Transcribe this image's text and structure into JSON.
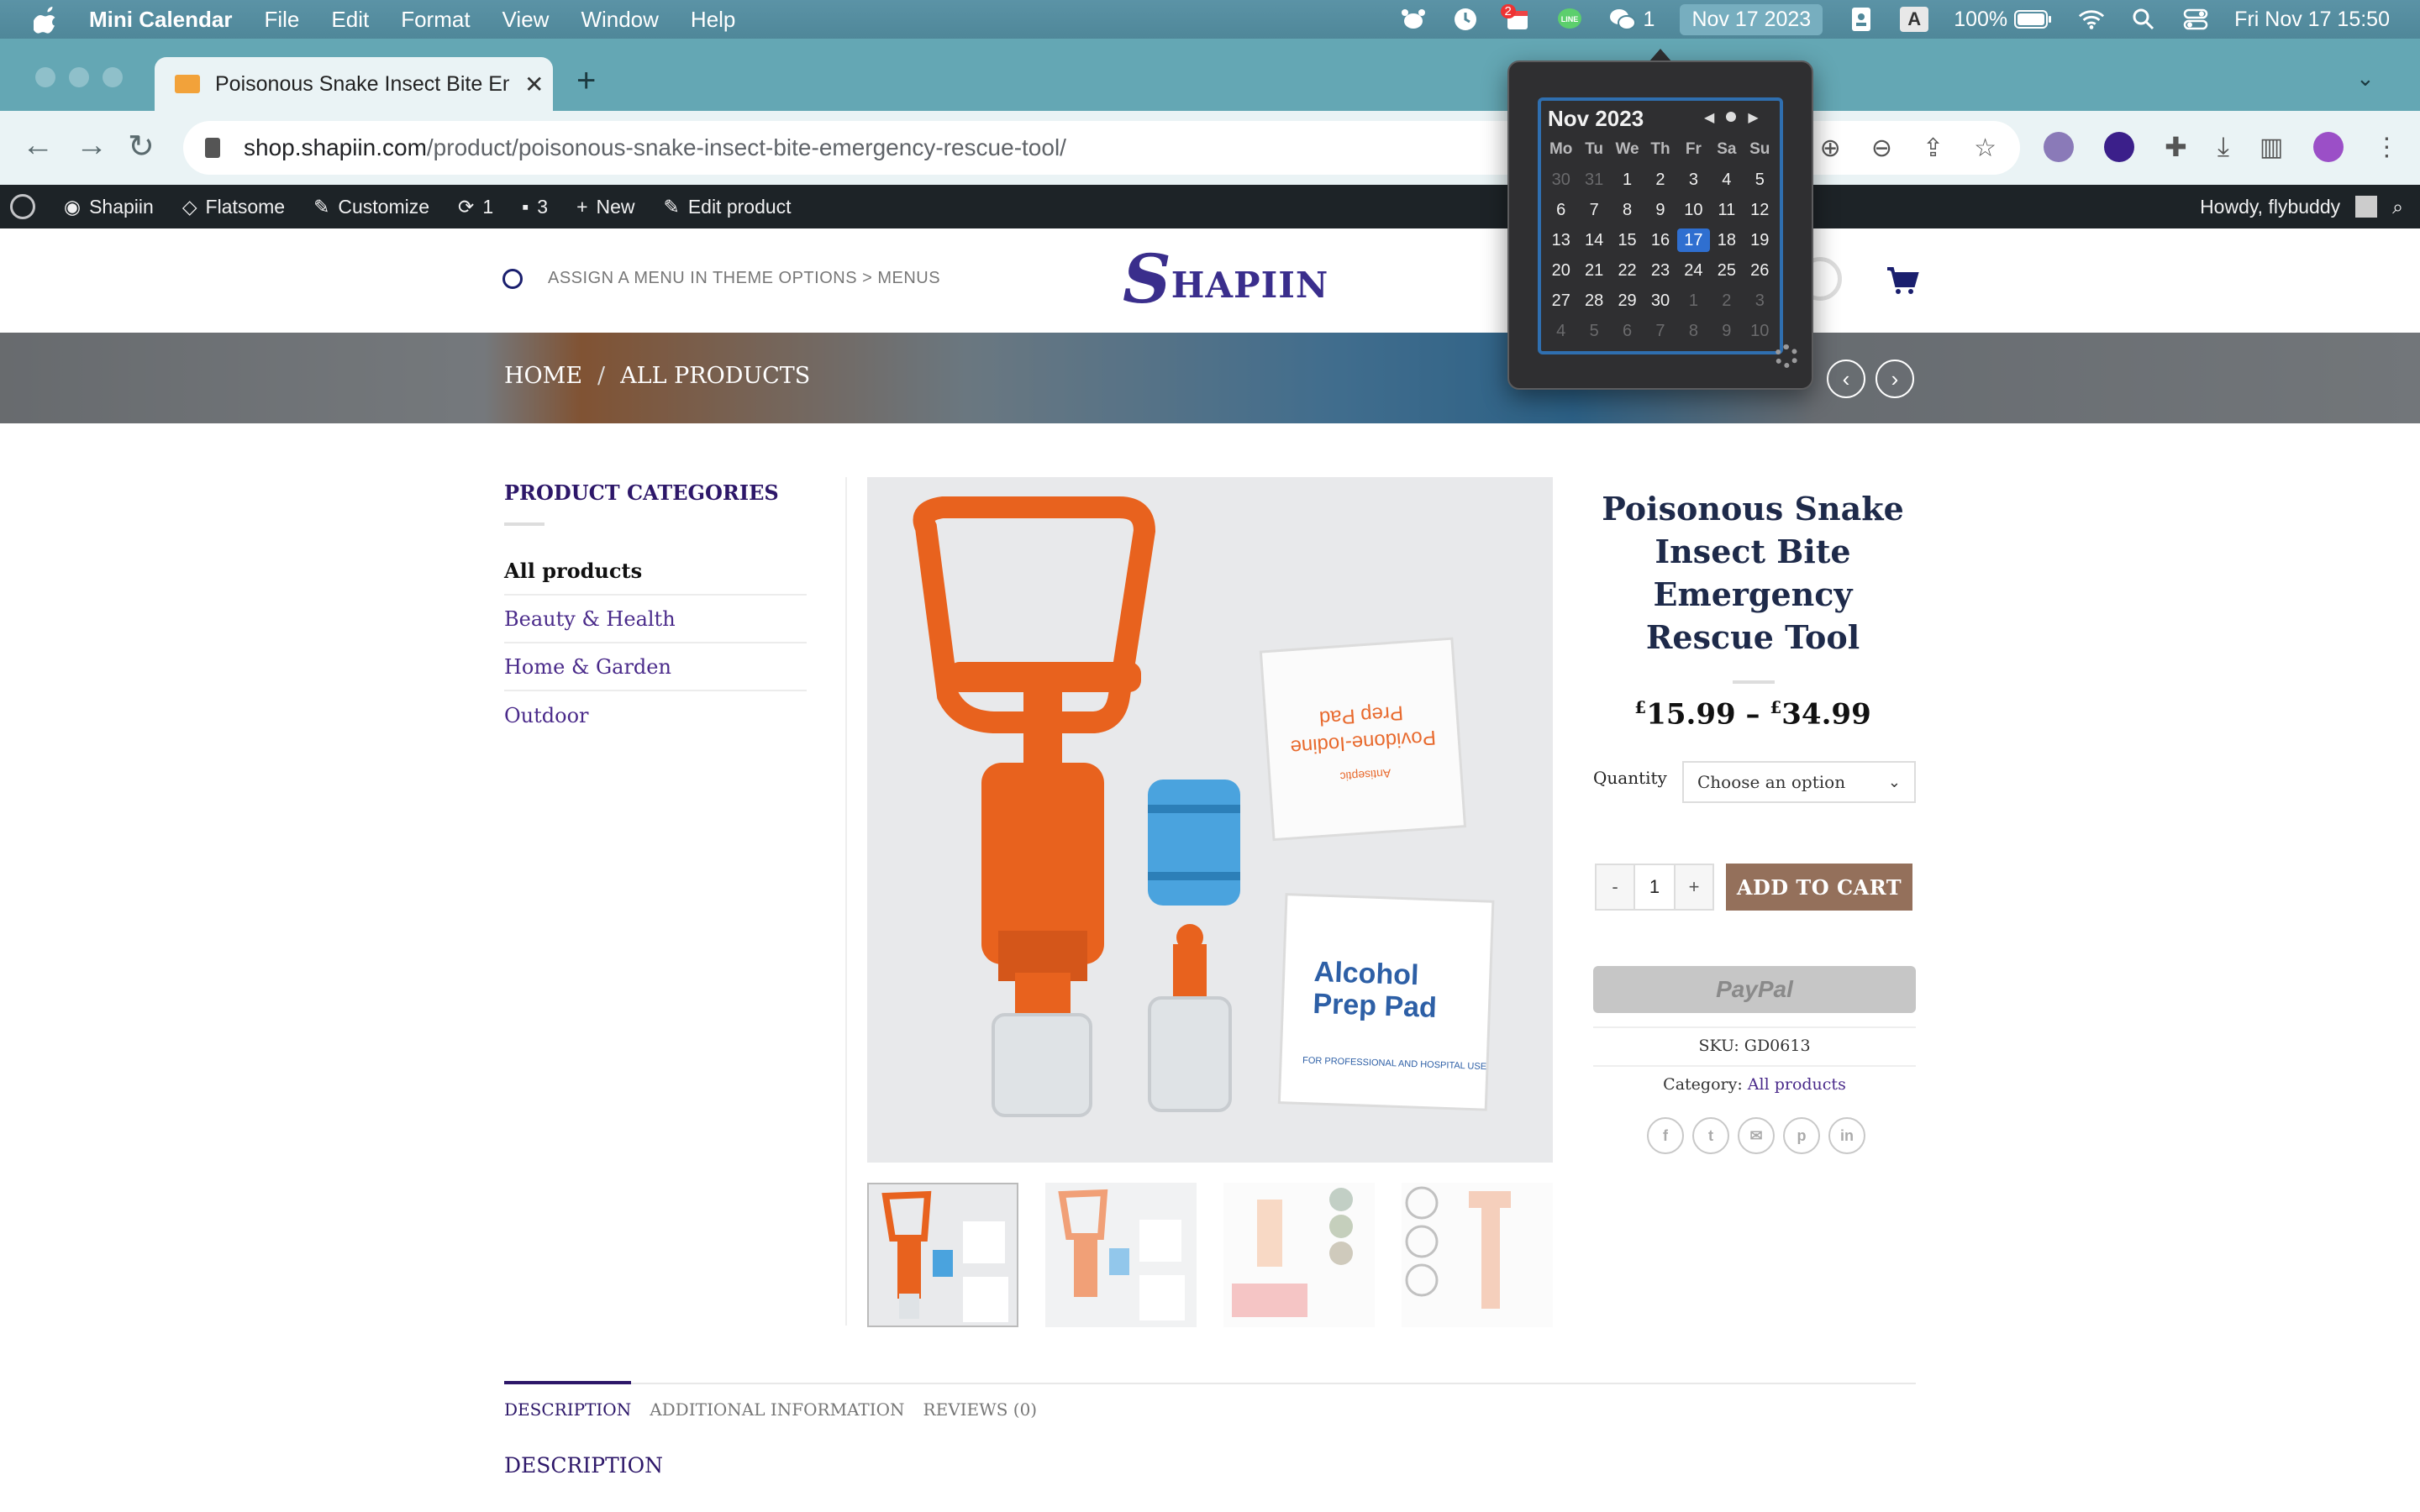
{
  "menubar": {
    "app_name": "Mini Calendar",
    "menus": [
      "File",
      "Edit",
      "Format",
      "View",
      "Window",
      "Help"
    ],
    "chat_count": "1",
    "calendar_badge": "2",
    "date_pill": "Nov 17 2023",
    "input_badge": "A",
    "battery": "100%",
    "clock": "Fri Nov 17  15:50"
  },
  "browser": {
    "tab_title": "Poisonous Snake Insect Bite Emergency Rescue Tool",
    "new_tab": "+",
    "url_host": "shop.shapiin.com",
    "url_path": "/product/poisonous-snake-insect-bite-emergency-rescue-tool/"
  },
  "wpbar": {
    "site": "Shapiin",
    "theme": "Flatsome",
    "customize": "Customize",
    "updates": "1",
    "comments": "3",
    "new": "New",
    "edit": "Edit product",
    "howdy": "Howdy, flybuddy"
  },
  "header": {
    "menu_hint": "ASSIGN A MENU IN THEME OPTIONS > MENUS",
    "logo_initial": "S",
    "logo_rest": "HAPIIN"
  },
  "breadcrumb": {
    "home": "HOME",
    "sep": "/",
    "current": "ALL PRODUCTS"
  },
  "sidebar": {
    "title": "PRODUCT CATEGORIES",
    "items": [
      "All products",
      "Beauty & Health",
      "Home & Garden",
      "Outdoor"
    ]
  },
  "product": {
    "title": "Poisonous Snake Insect Bite Emergency Rescue Tool",
    "price_low_symbol": "£",
    "price_low": "15.99",
    "price_dash": "–",
    "price_high_symbol": "£",
    "price_high": "34.99",
    "quantity_label": "Quantity",
    "select_placeholder": "Choose an option",
    "qty_minus": "-",
    "qty_value": "1",
    "qty_plus": "+",
    "add_to_cart": "ADD TO CART",
    "paypal": "PayPal",
    "sku": "SKU: GD0613",
    "category_label": "Category:",
    "category_value": "All products",
    "image_text_pad1": "Alcohol",
    "image_text_pad2": "Prep Pad",
    "image_text_pad3": "FOR PROFESSIONAL AND HOSPITAL USE",
    "image_text_iodine1": "Povidone-Iodine",
    "image_text_iodine2": "Prep Pad",
    "image_text_iodine3": "Antiseptic"
  },
  "tabs": {
    "description": "DESCRIPTION",
    "additional": "ADDITIONAL INFORMATION",
    "reviews": "REVIEWS (0)",
    "heading": "DESCRIPTION"
  },
  "calendar": {
    "month_title": "Nov 2023",
    "weekdays": [
      "Mo",
      "Tu",
      "We",
      "Th",
      "Fr",
      "Sa",
      "Su"
    ],
    "days": [
      "30",
      "31",
      "1",
      "2",
      "3",
      "4",
      "5",
      "6",
      "7",
      "8",
      "9",
      "10",
      "11",
      "12",
      "13",
      "14",
      "15",
      "16",
      "17",
      "18",
      "19",
      "20",
      "21",
      "22",
      "23",
      "24",
      "25",
      "26",
      "27",
      "28",
      "29",
      "30",
      "1",
      "2",
      "3",
      "4",
      "5",
      "6",
      "7",
      "8",
      "9",
      "10"
    ],
    "today": "17"
  },
  "colors": {
    "brand_purple": "#2d1769",
    "cart_brown": "#94705b",
    "calendar_today": "#2f6fd0"
  }
}
